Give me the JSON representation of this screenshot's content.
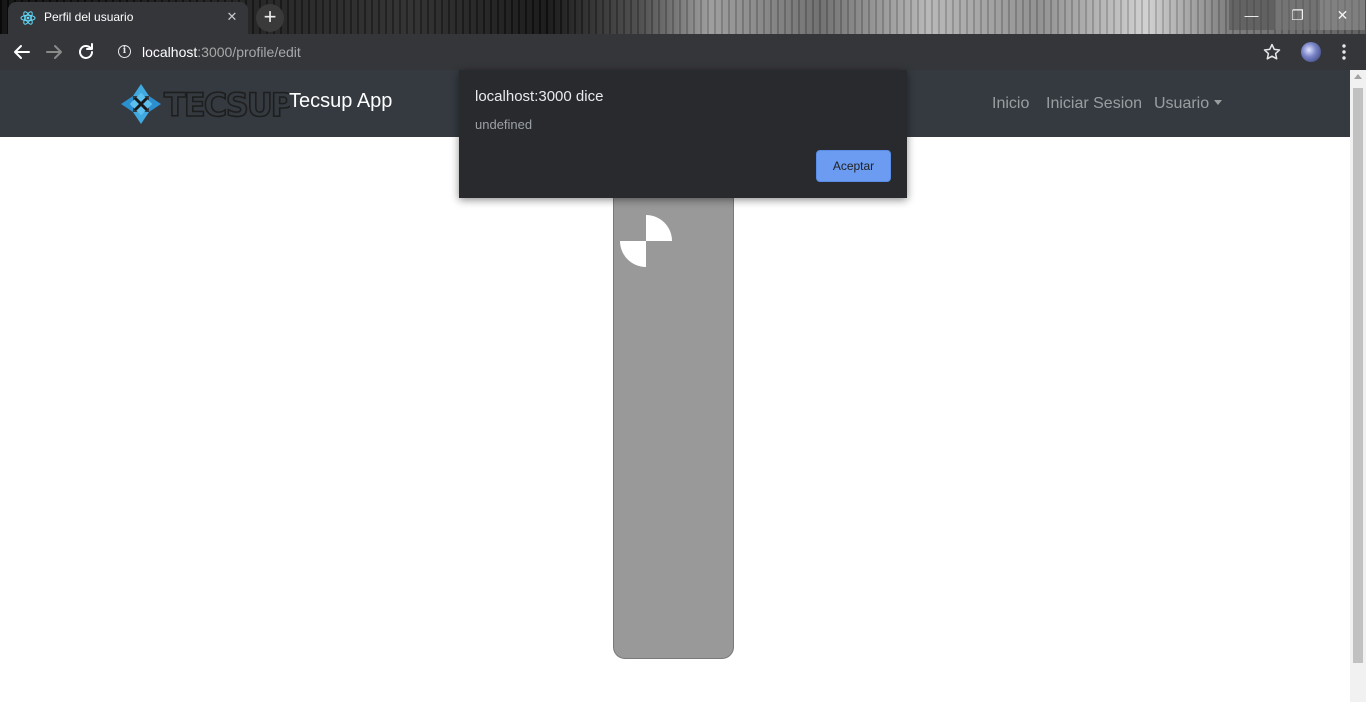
{
  "browser": {
    "tab_title": "Perfil del usuario",
    "tab_close_glyph": "✕",
    "new_tab_glyph": "+",
    "url_host": "localhost",
    "url_path": ":3000/profile/edit",
    "window_minimize_glyph": "—",
    "window_restore_glyph": "❐",
    "window_close_glyph": "✕",
    "icons": [
      "react-favicon-icon",
      "back-arrow-icon",
      "forward-arrow-icon",
      "reload-icon",
      "site-info-icon",
      "bookmark-star-icon",
      "profile-avatar",
      "chrome-menu-icon"
    ]
  },
  "navbar": {
    "brand_text": "Tecsup App",
    "links": {
      "home": "Inicio",
      "login": "Iniciar Sesion",
      "user": "Usuario"
    },
    "colors": {
      "background": "#343a40",
      "link": "rgba(255,255,255,0.5)",
      "brand": "#ffffff"
    },
    "logo_icon": "tecsup-logo"
  },
  "content": {
    "card_color": "#999999",
    "image_icon": "broken-image-placeholder-icon"
  },
  "dialog": {
    "title": "localhost:3000 dice",
    "message": "undefined",
    "ok_label": "Aceptar",
    "colors": {
      "background": "#292a2d",
      "button": "#6b9cf2"
    }
  }
}
